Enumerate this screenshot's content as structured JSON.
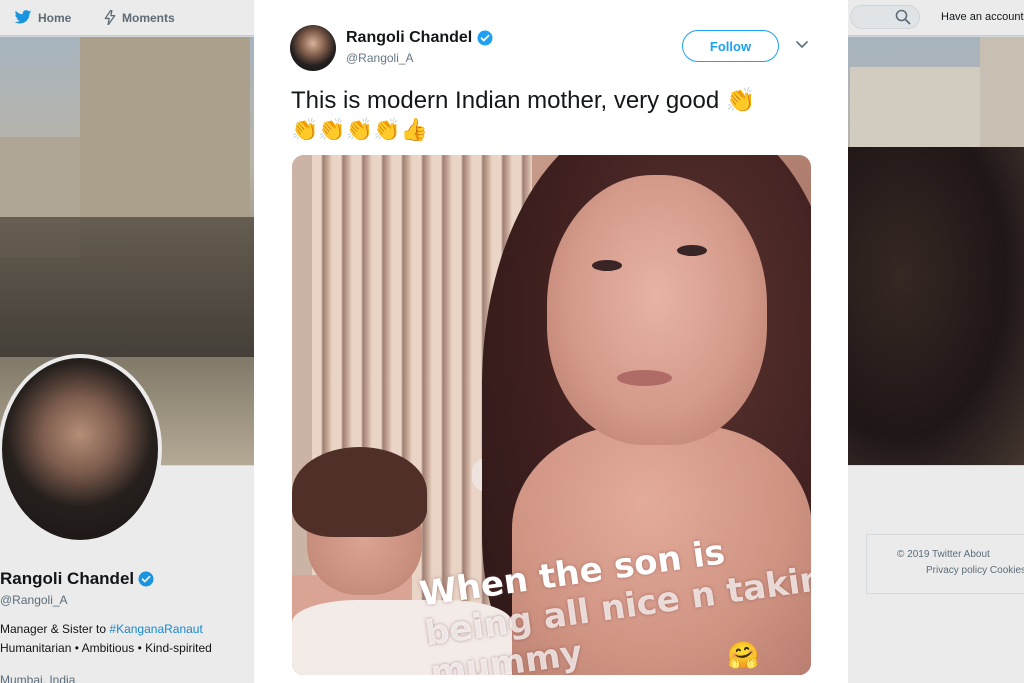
{
  "nav": {
    "home_label": "Home",
    "moments_label": "Moments",
    "have_account": "Have an account"
  },
  "profile": {
    "name": "Rangoli Chandel",
    "handle": "@Rangoli_A",
    "bio_line1_prefix": "Manager & Sister to ",
    "bio_line1_link": "#KanganaRanaut",
    "bio_line2": "Humanitarian • Ambitious • Kind-spirited",
    "location": "Mumbai, India"
  },
  "footer": {
    "line1": "© 2019 Twitter   About",
    "line2": "Privacy policy   Cookies"
  },
  "tweet": {
    "author_name": "Rangoli Chandel",
    "author_handle": "@Rangoli_A",
    "follow_label": "Follow",
    "text": "This is modern Indian mother, very good 👏",
    "emoji_line": "👏👏👏👏👍",
    "image_caption_line1": "When the son is",
    "image_caption_line2": "being all nice n takin",
    "image_caption_line3": "mummy",
    "image_emoji": "🤗"
  },
  "colors": {
    "twitter_blue": "#1da1f2",
    "verified_blue": "#1da1f2",
    "text_primary": "#14171a",
    "text_secondary": "#657786"
  },
  "icons": {
    "home": "bird-icon",
    "moments": "lightning-icon",
    "search": "search-icon",
    "verified": "verified-badge-icon",
    "more": "chevron-down-icon"
  }
}
